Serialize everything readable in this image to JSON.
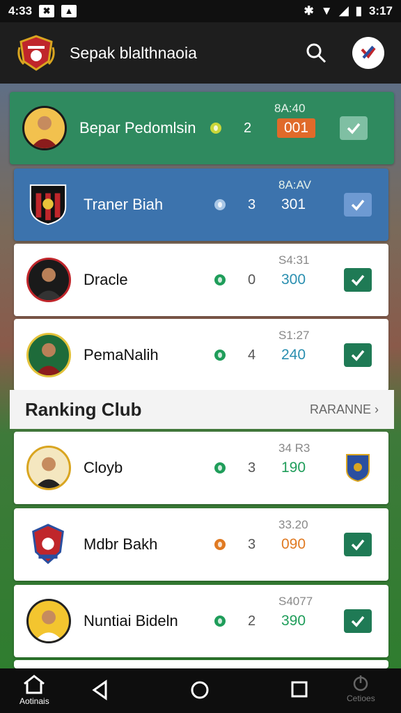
{
  "status": {
    "time": "4:33",
    "clock_right": "3:17"
  },
  "app": {
    "title": "Sepak blalthnaoia"
  },
  "rows_top": [
    {
      "name": "Bepar Pedomlsin",
      "rank": "2",
      "sub": "8A:40",
      "pts": "001",
      "style": "green",
      "dot_color": "#c9d63a"
    },
    {
      "name": "Traner Biah",
      "rank": "3",
      "sub": "8A:AV",
      "pts": "301",
      "style": "blue",
      "dot_color": "#a9c7e6"
    },
    {
      "name": "Dracle",
      "rank": "0",
      "sub": "S4:31",
      "pts": "300",
      "style": "white",
      "dot_color": "#1f9d5a",
      "pts_color": "#2a8fb0"
    },
    {
      "name": "PemaNalih",
      "rank": "4",
      "sub": "S1:27",
      "pts": "240",
      "style": "white",
      "dot_color": "#1f9d5a",
      "pts_color": "#2a8fb0"
    }
  ],
  "section": {
    "title": "Ranking Club",
    "link": "RARANNE"
  },
  "rows_bottom": [
    {
      "name": "Cloyb",
      "rank": "3",
      "sub": "34 R3",
      "pts": "190",
      "dot_color": "#1f9d5a",
      "pts_color": "#1f9d5a",
      "action": "shield"
    },
    {
      "name": "Mdbr Bakh",
      "rank": "3",
      "sub": "33.20",
      "pts": "090",
      "dot_color": "#e07a22",
      "pts_color": "#e07a22",
      "action": "check"
    },
    {
      "name": "Nuntiai Bideln",
      "rank": "2",
      "sub": "S4077",
      "pts": "390",
      "dot_color": "#1f9d5a",
      "pts_color": "#1f9d5a",
      "action": "check"
    }
  ],
  "nav": {
    "home_label": "Aotinais",
    "right_label": "Cetioes"
  },
  "colors": {
    "green": "#2f8a5f",
    "blue": "#3c73ad",
    "check_green": "#1f7a55"
  }
}
